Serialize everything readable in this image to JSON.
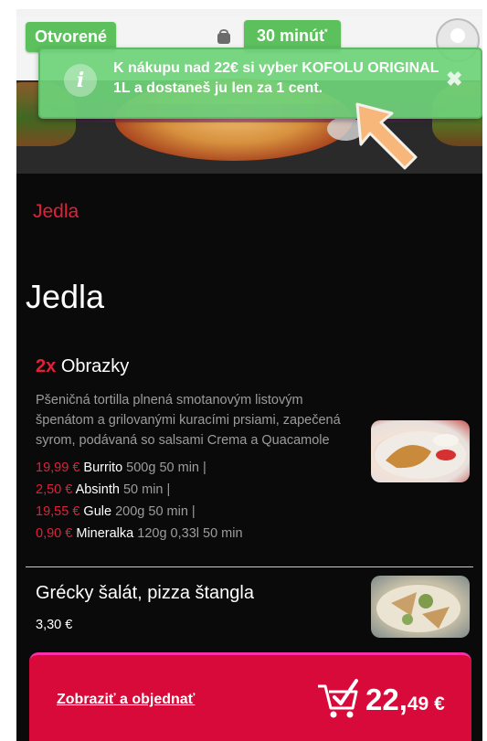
{
  "header": {
    "status_open": "Otvorené",
    "delivery_time": "30 minút",
    "delivery_time_mark": "*"
  },
  "toast": {
    "icon": "i",
    "message": "K nákupu nad 22€ si vyber KOFOLU ORIGINAL 1L a dostaneš ju len za 1 cent."
  },
  "menu": {
    "section_label": "Jedla",
    "section_title": "Jedla",
    "items": [
      {
        "qty": "2x",
        "name": "Obrazky",
        "description": "Pšeničná tortilla plnená smotanovým listovým špenátom a grilovanými kuracími prsiami, zapečená syrom, podávaná so salsami Crema a Quacamole",
        "variants": [
          {
            "price": "19,99 €",
            "name": "Burrito",
            "meta": "500g   50 min   |"
          },
          {
            "price": "2,50 €",
            "name": "Absinth",
            "meta": "50 min   |"
          },
          {
            "price": "19,55 €",
            "name": "Gule",
            "meta": "200g   50 min   |"
          },
          {
            "price": "0,90 €",
            "name": "Mineralka",
            "meta": "120g   0,33l   50 min"
          }
        ]
      },
      {
        "name": "Grécky šalát, pizza štangla",
        "price": "3,30 €"
      }
    ]
  },
  "cart": {
    "link_label": "Zobraziť a objednať",
    "total_whole": "22,",
    "total_cents": "49 €"
  },
  "colors": {
    "accent_red": "#e0213a",
    "pill_green": "#5cc15c",
    "cart_red": "#d70a3a"
  }
}
